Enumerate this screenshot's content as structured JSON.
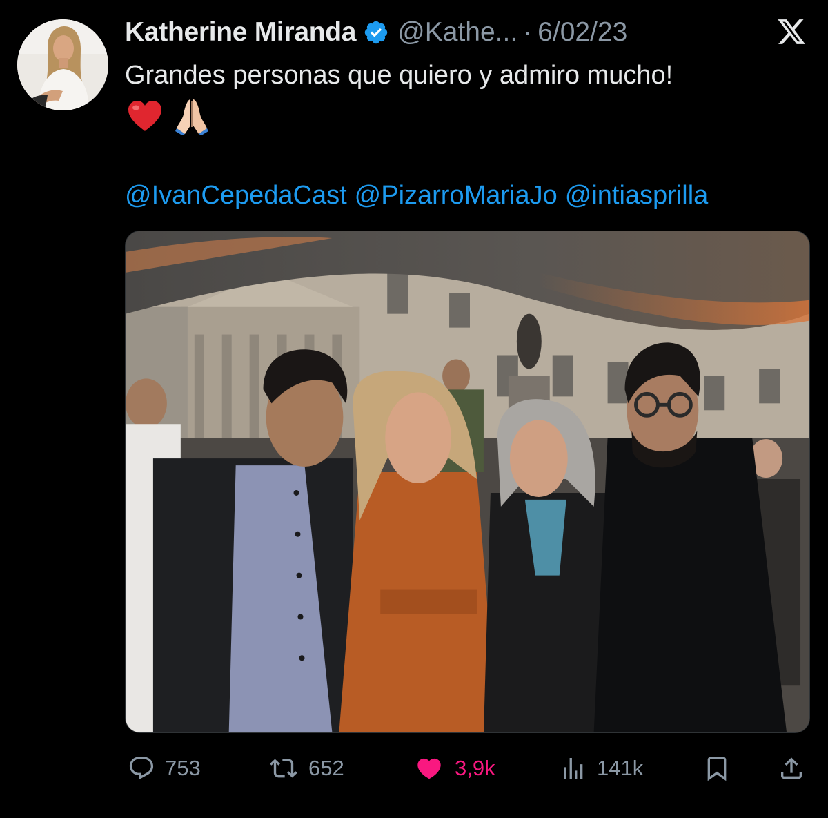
{
  "tweet": {
    "author": {
      "display_name": "Katherine Miranda",
      "handle": "@Kathe...",
      "verified": true
    },
    "separator": "·",
    "date": "6/02/23",
    "text": "Grandes personas que quiero y admiro mucho!",
    "emojis": [
      "heart-emoji",
      "folded-hands-emoji"
    ],
    "mentions": [
      "@IvanCepedaCast",
      "@PizarroMariaJo",
      "@intiasprilla"
    ]
  },
  "actions": {
    "replies": "753",
    "reposts": "652",
    "likes": "3,9k",
    "views": "141k"
  },
  "colors": {
    "background": "#000000",
    "text_primary": "#e7e9ea",
    "text_secondary": "#8b98a5",
    "link": "#1d9bf0",
    "like": "#f91880",
    "verified_badge": "#1d9bf0"
  }
}
